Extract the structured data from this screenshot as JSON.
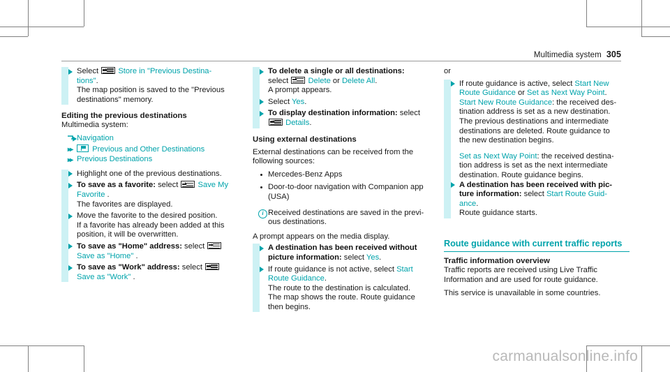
{
  "header": {
    "section": "Multimedia system",
    "page": "305"
  },
  "watermark": "carmanualsonline.info",
  "col1": {
    "step1_line1_pre": "Select",
    "step1_line1_link": "Store in \"Previous Destina-",
    "step1_line2_link": "tions\"",
    "step1_line2_post": ".",
    "step1_detail1": "The map position is saved to the \"Previous",
    "step1_detail2": "destinations\" memory.",
    "heading_editing": "Editing the previous destinations",
    "multimedia_label": "Multimedia system:",
    "flow_navigation": "Navigation",
    "flow_prev_other": "Previous and Other Destinations",
    "flow_prev_dest": "Previous Destinations",
    "step2": "Highlight one of the previous destinations.",
    "step3_bold": "To save as a favorite:",
    "step3_sel": "select",
    "step3_link1": "Save My",
    "step3_link2": "Favorite",
    "step3_dot": ".",
    "step3_detail": "The favorites are displayed.",
    "step4_l1": "Move the favorite to the desired position.",
    "step4_l2": "If a favorite has already been added at this",
    "step4_l3": "position, it will be overwritten.",
    "step5_bold": "To save as \"Home\" address:",
    "step5_sel": "select",
    "step5_link": "Save as \"Home\"",
    "step5_dot": ".",
    "step6_bold": "To save as \"Work\" address:",
    "step6_sel": "select",
    "step6_link": "Save as \"Work\"",
    "step6_dot": "."
  },
  "col2": {
    "step1_bold": "To delete a single or all destinations:",
    "step1_sel": "select",
    "step1_link1": "Delete",
    "step1_or": "or",
    "step1_link2": "Delete All",
    "step1_dot": ".",
    "step1_detail": "A prompt appears.",
    "step2_pre": "Select",
    "step2_link": "Yes",
    "step2_dot": ".",
    "step3_bold": "To display destination information:",
    "step3_sel": "select",
    "step3_link": "Details",
    "step3_dot": ".",
    "heading_external": "Using external destinations",
    "intro_l1": "External destinations can be received from the",
    "intro_l2": "following sources:",
    "bullet1": "Mercedes-Benz Apps",
    "bullet2_l1": "Door-to-door navigation with Companion app",
    "bullet2_l2": "(USA)",
    "note_l1": "Received destinations are saved in the previ-",
    "note_l2": "ous destinations.",
    "prompt_line": "A prompt appears on the media display.",
    "step4_bold_l1": "A destination has been received without",
    "step4_bold_l2": "picture information:",
    "step4_sel": "select",
    "step4_link": "Yes",
    "step4_dot": ".",
    "step5_l1_pre": "If route guidance is not active, select",
    "step5_l1_link": "Start",
    "step5_l2_link": "Route Guidance",
    "step5_dot": ".",
    "step5_d1": "The route to the destination is calculated.",
    "step5_d2": "The map shows the route. Route guidance",
    "step5_d3": "then begins."
  },
  "col3": {
    "or_label": "or",
    "step1_pre": "If route guidance is active, select",
    "step1_link1a": "Start New",
    "step1_link1b": "Route Guidance",
    "step1_or": "or",
    "step1_link2": "Set as Next Way Point",
    "step1_dot": ".",
    "step1_d1_link": "Start New Route Guidance",
    "step1_d1_rest": ": the received des-",
    "step1_d2": "tination address is set as a new destination.",
    "step1_d3": "The previous destinations and intermediate",
    "step1_d4": "destinations are deleted. Route guidance to",
    "step1_d5": "the new destination begins.",
    "step1_e1_link": "Set as Next Way Point",
    "step1_e1_rest": ": the received destina-",
    "step1_e2": "tion address is set as the next intermediate",
    "step1_e3": "destination. Route guidance begins.",
    "step2_bold_l1": "A destination has been received with pic-",
    "step2_bold_l2": "ture information:",
    "step2_sel": "select",
    "step2_link1": "Start Route Guid-",
    "step2_link2": "ance",
    "step2_dot": ".",
    "step2_detail": "Route guidance starts.",
    "section_heading": "Route guidance with current traffic reports",
    "sub_heading": "Traffic information overview",
    "para1_l1": "Traffic reports are received using Live Traffic",
    "para1_l2": "Information and are used for route guidance.",
    "para2": "This service is unavailable in some countries."
  }
}
